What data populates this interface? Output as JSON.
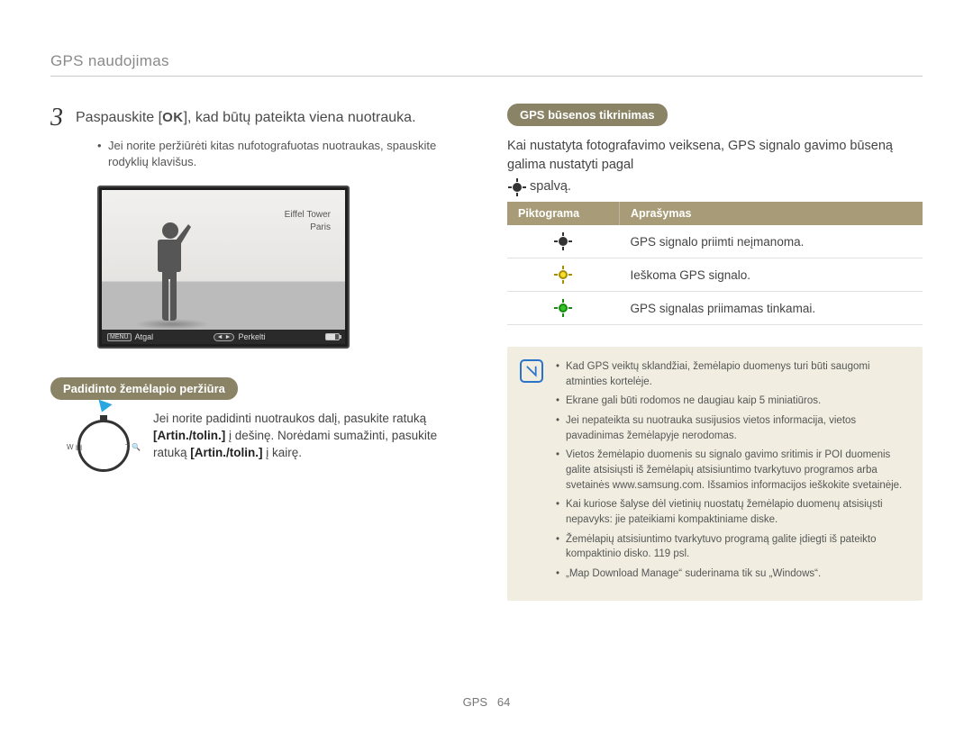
{
  "header": {
    "title": "GPS naudojimas"
  },
  "step": {
    "number": "3",
    "prefix": "Paspauskite [",
    "ok": "OK",
    "suffix": "], kad būtų pateikta viena nuotrauka.",
    "bullet": "Jei norite peržiūrėti kitas nufotografuotas nuotraukas, spauskite rodyklių klavišus."
  },
  "camera": {
    "place1": "Eiffel Tower",
    "place2": "Paris",
    "menu": "MENU",
    "back": "Atgal",
    "move_icon": "◄ ►",
    "move": "Perkelti"
  },
  "zoom_heading": "Padidinto žemėlapio peržiūra",
  "dial": {
    "left": "W",
    "right": "T",
    "text_a": "Jei norite padidinti nuotraukos dalį, pasukite ratuką ",
    "bold1": "[Artin./tolin.]",
    "text_b": " į dešinę. Norėdami sumažinti, pasukite ratuką ",
    "bold2": "[Artin./tolin.]",
    "text_c": " į kairę."
  },
  "status": {
    "heading": "GPS būsenos tikrinimas",
    "intro_a": "Kai nustatyta fotografavimo veiksena, GPS signalo gavimo būseną galima nustatyti pagal ",
    "intro_b": " spalvą."
  },
  "table": {
    "h_icon": "Piktograma",
    "h_desc": "Aprašymas",
    "rows": [
      {
        "color": "black",
        "desc": "GPS signalo priimti neįmanoma."
      },
      {
        "color": "yellow",
        "desc": "Ieškoma GPS signalo."
      },
      {
        "color": "green",
        "desc": "GPS signalas priimamas tinkamai."
      }
    ]
  },
  "notes": [
    "Kad GPS veiktų sklandžiai, žemėlapio duomenys turi būti saugomi atminties kortelėje.",
    "Ekrane gali būti rodomos ne daugiau kaip 5 miniatiūros.",
    "Jei nepateikta su nuotrauka susijusios vietos informacija, vietos pavadinimas žemėlapyje nerodomas.",
    "Vietos žemėlapio duomenis su signalo gavimo sritimis ir POI duomenis galite atsisiųsti iš žemėlapių atsisiuntimo tvarkytuvo programos arba svetainės www.samsung.com. Išsamios informacijos ieškokite svetainėje.",
    "Kai kuriose šalyse dėl vietinių nuostatų žemėlapio duomenų atsisiųsti nepavyks: jie pateikiami kompaktiniame diske.",
    "Žemėlapių atsisiuntimo tvarkytuvo programą galite įdiegti iš pateikto kompaktinio disko. 119 psl.",
    "„Map Download Manage“ suderinama tik su „Windows“."
  ],
  "footer": {
    "section": "GPS",
    "page": "64"
  }
}
